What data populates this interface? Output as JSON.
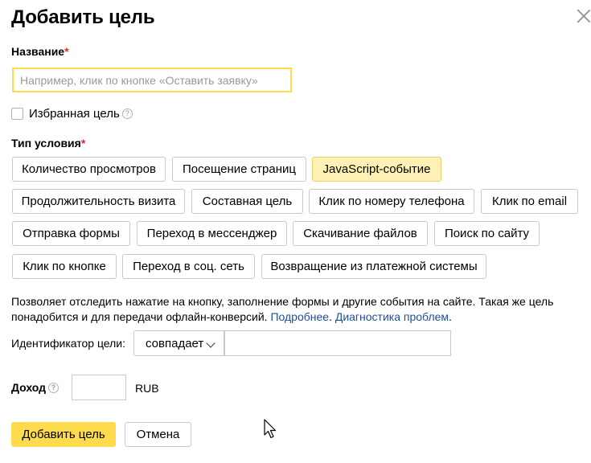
{
  "dialog": {
    "title": "Добавить цель",
    "close_icon": "close-icon"
  },
  "name_field": {
    "label": "Название",
    "required_mark": "*",
    "placeholder": "Например, клик по кнопке «Оставить заявку»",
    "value": ""
  },
  "favorite": {
    "label": "Избранная цель",
    "checked": false,
    "help_glyph": "?"
  },
  "condition_type": {
    "label": "Тип условия",
    "required_mark": "*",
    "options": [
      {
        "label": "Количество просмотров",
        "active": false
      },
      {
        "label": "Посещение страниц",
        "active": false
      },
      {
        "label": "JavaScript-событие",
        "active": true
      },
      {
        "label": "Продолжительность визита",
        "active": false
      },
      {
        "label": "Составная цель",
        "active": false
      },
      {
        "label": "Клик по номеру телефона",
        "active": false
      },
      {
        "label": "Клик по email",
        "active": false
      },
      {
        "label": "Отправка формы",
        "active": false
      },
      {
        "label": "Переход в мессенджер",
        "active": false
      },
      {
        "label": "Скачивание файлов",
        "active": false
      },
      {
        "label": "Поиск по сайту",
        "active": false
      },
      {
        "label": "Клик по кнопке",
        "active": false
      },
      {
        "label": "Переход в соц. сеть",
        "active": false
      },
      {
        "label": "Возвращение из платежной системы",
        "active": false
      }
    ]
  },
  "description": {
    "text": "Позволяет отследить нажатие на кнопку, заполнение формы и другие события на сайте. Такая же цель понадобится и для передачи офлайн-конверсий. ",
    "link_more": "Подробнее",
    "separator": ". ",
    "link_diagnostics": "Диагностика проблем",
    "end": "."
  },
  "identifier": {
    "label": "Идентификатор цели:",
    "match_selected": "совпадает",
    "value": ""
  },
  "income": {
    "label": "Доход",
    "help_glyph": "?",
    "value": "",
    "currency": "RUB"
  },
  "actions": {
    "submit_label": "Добавить цель",
    "cancel_label": "Отмена"
  },
  "colors": {
    "accent_yellow": "#ffdb4d",
    "active_option_bg": "#fff1b3",
    "link_blue": "#1f4f99",
    "required_red": "#e8252d"
  }
}
